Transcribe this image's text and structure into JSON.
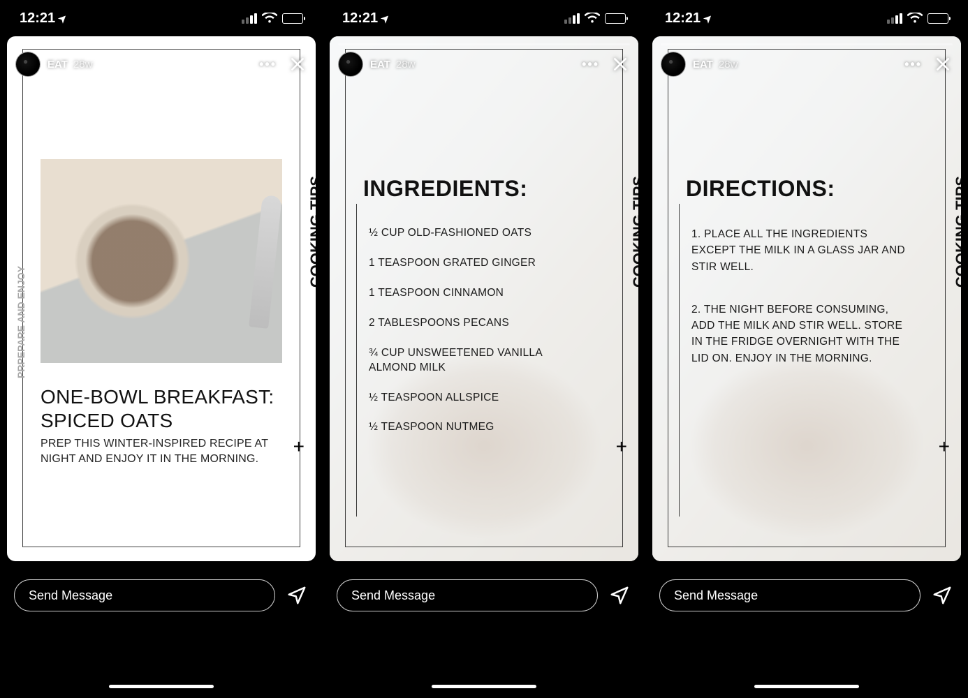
{
  "statusbar": {
    "time": "12:21"
  },
  "story": {
    "account": "EAT",
    "age": "28w",
    "right_tag": "COOKING TIPS",
    "left_tag": "PRPEPARE AND ENJOY"
  },
  "card1": {
    "title_l1": "ONE-BOWL BREAKFAST:",
    "title_l2": "SPICED OATS",
    "subtitle": "PREP THIS WINTER-INSPIRED RECIPE AT NIGHT AND ENJOY IT IN THE MORNING."
  },
  "card2": {
    "heading": "INGREDIENTS:",
    "items": [
      "½ CUP OLD-FASHIONED OATS",
      "1 TEASPOON GRATED GINGER",
      "1 TEASPOON CINNAMON",
      "2 TABLESPOONS PECANS",
      "¾ CUP UNSWEETENED VANILLA ALMOND MILK",
      "½ TEASPOON ALLSPICE",
      "½ TEASPOON NUTMEG"
    ]
  },
  "card3": {
    "heading": "DIRECTIONS:",
    "items": [
      "1. PLACE ALL THE INGREDIENTS EXCEPT THE MILK IN A GLASS JAR AND STIR WELL.",
      "2. THE NIGHT BEFORE CONSUMING, ADD THE MILK AND STIR WELL. STORE IN THE FRIDGE OVERNIGHT WITH THE LID ON. ENJOY IN THE MORNING."
    ]
  },
  "compose": {
    "placeholder": "Send Message"
  }
}
